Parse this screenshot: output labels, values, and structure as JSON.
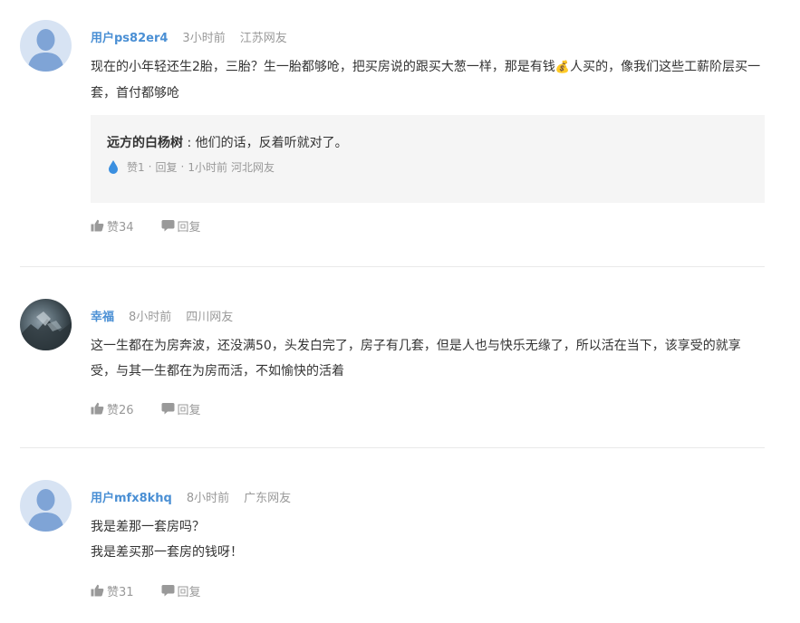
{
  "comments": [
    {
      "username": "用户ps82er4",
      "time": "3小时前",
      "region": "江苏网友",
      "text_before": "现在的小年轻还生2胎，三胎？生一胎都够呛，把买房说的跟买大葱一样，那是有钱",
      "money_icon": "💰",
      "text_after": "人买的，像我们这些工薪阶层买一套，首付都够呛",
      "reply": {
        "author": "远方的白杨树",
        "separator": " : ",
        "text": "他们的话，反着听就对了。",
        "likes": "赞1",
        "dot": "·",
        "reply_label": "回复",
        "time": "1小时前",
        "region": "河北网友"
      },
      "likes": "赞34",
      "reply_label": "回复"
    },
    {
      "username": "幸福",
      "time": "8小时前",
      "region": "四川网友",
      "text": "这一生都在为房奔波，还没满50，头发白完了，房子有几套，但是人也与快乐无缘了，所以活在当下，该享受的就享受，与其一生都在为房而活，不如愉快的活着",
      "likes": "赞26",
      "reply_label": "回复"
    },
    {
      "username": "用户mfx8khq",
      "time": "8小时前",
      "region": "广东网友",
      "line1": "我是差那一套房吗？",
      "line2": "我是差买那一套房的钱呀！",
      "likes": "赞31",
      "reply_label": "回复"
    }
  ],
  "colors": {
    "username": "#4a8fd4",
    "meta": "#999999",
    "reply_bg": "#f5f5f5",
    "avatar_default": "#7fa4d6"
  },
  "icons": {
    "avatar_default": "user-silhouette-icon",
    "like": "thumbs-up-icon",
    "reply": "speech-bubble-icon",
    "drop": "water-drop-icon",
    "money": "money-bag-icon"
  }
}
